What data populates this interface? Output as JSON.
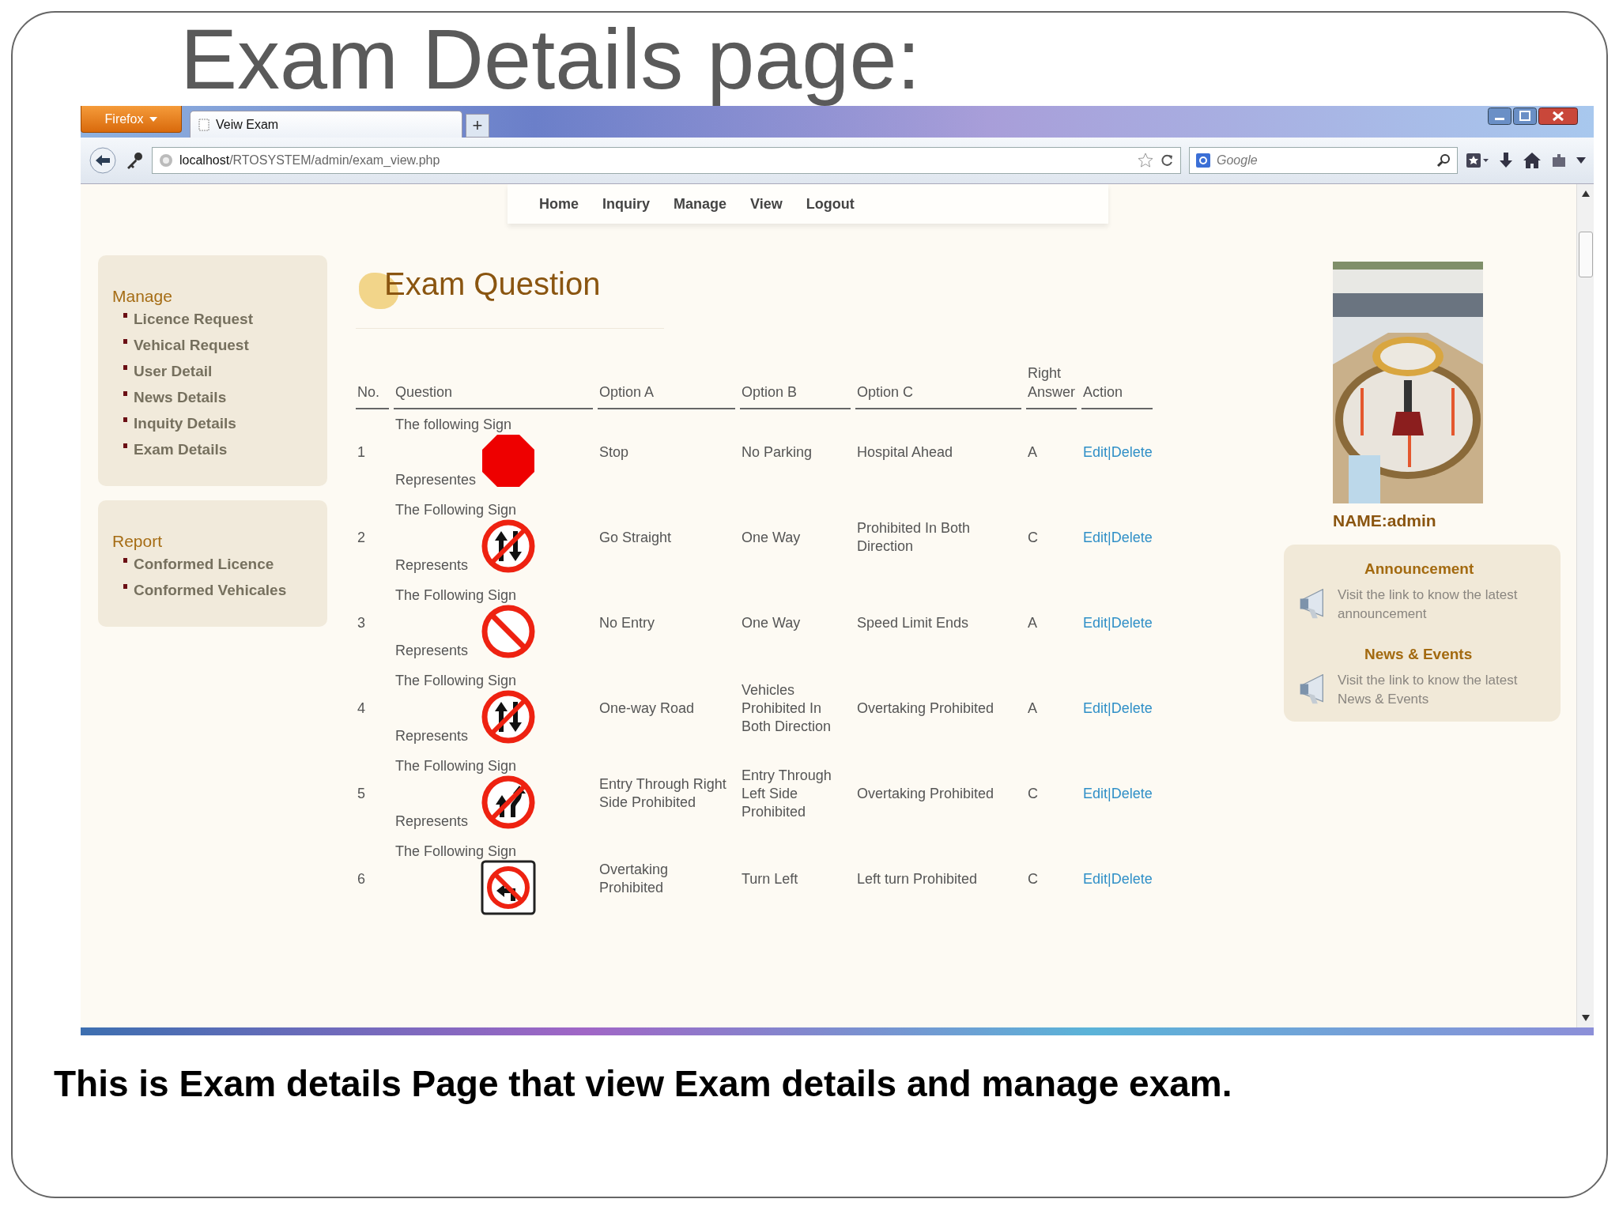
{
  "slide": {
    "title": "Exam Details page:",
    "caption": "This is Exam details Page that view Exam details and manage exam."
  },
  "browser": {
    "menu_button": "Firefox",
    "tab_title": "Veiw Exam",
    "new_tab": "+",
    "url_host": "localhost",
    "url_path": "/RTOSYSTEM/admin/exam_view.php",
    "search_placeholder": "Google"
  },
  "nav": [
    "Home",
    "Inquiry",
    "Manage",
    "View",
    "Logout"
  ],
  "sidebar": [
    {
      "heading": "Manage",
      "items": [
        "Licence Request",
        "Vehical Request",
        "User Detail",
        "News Details",
        "Inquity Details",
        "Exam Details"
      ]
    },
    {
      "heading": "Report",
      "items": [
        "Conformed Licence",
        "Conformed Vehicales"
      ]
    }
  ],
  "heading": "Exam Question",
  "table": {
    "columns": [
      "No.",
      "Question",
      "Option A",
      "Option B",
      "Option C",
      "Right Answer",
      "Action"
    ],
    "rows": [
      {
        "no": "1",
        "question_top": "The following Sign",
        "question_bottom": "Representes",
        "kind": "stop",
        "option_a": "Stop",
        "option_b": "No Parking",
        "option_c": "Hospital Ahead",
        "answer": "A",
        "edit": "Edit",
        "separator": "|",
        "delete": "Delete"
      },
      {
        "no": "2",
        "question_top": "The Following Sign",
        "question_bottom": "Represents",
        "kind": "two_way",
        "option_a": "Go Straight",
        "option_b": "One Way",
        "option_c": "Prohibited In Both Direction",
        "answer": "C",
        "edit": "Edit",
        "separator": "|",
        "delete": "Delete"
      },
      {
        "no": "3",
        "question_top": "The Following Sign",
        "question_bottom": "Represents",
        "kind": "no_entry",
        "option_a": "No Entry",
        "option_b": "One Way",
        "option_c": "Speed Limit Ends",
        "answer": "A",
        "edit": "Edit",
        "separator": "|",
        "delete": "Delete"
      },
      {
        "no": "4",
        "question_top": "The Following Sign",
        "question_bottom": "Represents",
        "kind": "two_way",
        "option_a": "One-way Road",
        "option_b": "Vehicles Prohibited In Both Direction",
        "option_c": "Overtaking Prohibited",
        "answer": "A",
        "edit": "Edit",
        "separator": "|",
        "delete": "Delete"
      },
      {
        "no": "5",
        "question_top": "The Following Sign",
        "question_bottom": "Represents",
        "kind": "overtaking",
        "option_a": "Entry Through Right Side Prohibited",
        "option_b": "Entry Through Left Side Prohibited",
        "option_c": "Overtaking Prohibited",
        "answer": "C",
        "edit": "Edit",
        "separator": "|",
        "delete": "Delete"
      },
      {
        "no": "6",
        "question_top": "The Following Sign",
        "kind": "left_turn",
        "option_a": "Overtaking Prohibited",
        "option_b": "Turn Left",
        "option_c": "Left turn Prohibited",
        "answer": "C",
        "edit": "Edit",
        "separator": "|",
        "delete": "Delete"
      }
    ]
  },
  "profile": {
    "name": "NAME:admin"
  },
  "notices": [
    {
      "title": "Announcement",
      "text": "Visit the link to know the latest announcement"
    },
    {
      "title": "News & Events",
      "text": "Visit the link to know the latest News & Events"
    }
  ]
}
